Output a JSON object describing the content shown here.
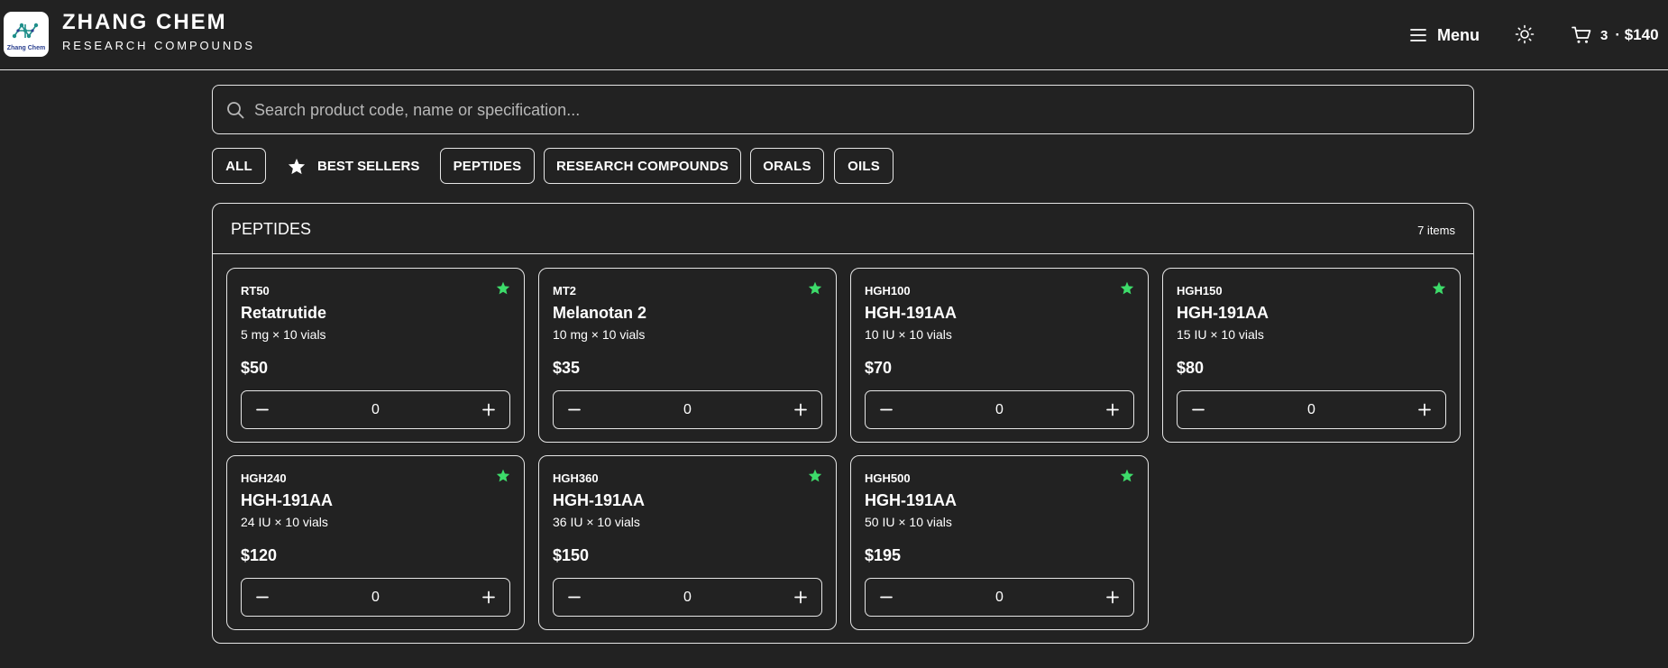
{
  "header": {
    "logo_text": "Zhang Chem",
    "title": "ZHANG CHEM",
    "subtitle": "RESEARCH COMPOUNDS",
    "menu_label": "Menu",
    "cart_count": "3",
    "cart_total": "· $140"
  },
  "search": {
    "placeholder": "Search product code, name or specification..."
  },
  "filters": {
    "all": "ALL",
    "best_sellers": "BEST SELLERS",
    "peptides": "PEPTIDES",
    "research_compounds": "RESEARCH COMPOUNDS",
    "orals": "ORALS",
    "oils": "OILS"
  },
  "section": {
    "title": "PEPTIDES",
    "count": "7 items"
  },
  "products": [
    {
      "code": "RT50",
      "name": "Retatrutide",
      "spec": "5 mg × 10 vials",
      "price": "$50",
      "qty": "0"
    },
    {
      "code": "MT2",
      "name": "Melanotan 2",
      "spec": "10 mg × 10 vials",
      "price": "$35",
      "qty": "0"
    },
    {
      "code": "HGH100",
      "name": "HGH-191AA",
      "spec": "10 IU × 10 vials",
      "price": "$70",
      "qty": "0"
    },
    {
      "code": "HGH150",
      "name": "HGH-191AA",
      "spec": "15 IU × 10 vials",
      "price": "$80",
      "qty": "0"
    },
    {
      "code": "HGH240",
      "name": "HGH-191AA",
      "spec": "24 IU × 10 vials",
      "price": "$120",
      "qty": "0"
    },
    {
      "code": "HGH360",
      "name": "HGH-191AA",
      "spec": "36 IU × 10 vials",
      "price": "$150",
      "qty": "0"
    },
    {
      "code": "HGH500",
      "name": "HGH-191AA",
      "spec": "50 IU × 10 vials",
      "price": "$195",
      "qty": "0"
    }
  ],
  "colors": {
    "background": "#222222",
    "border": "#e6e6e6",
    "star": "#3ddc6a"
  },
  "icons": {
    "menu": "hamburger-icon",
    "theme": "sun-icon",
    "cart": "cart-icon",
    "search": "search-icon",
    "best": "star-icon",
    "favorite": "star-icon",
    "decrement": "minus-icon",
    "increment": "plus-icon"
  }
}
